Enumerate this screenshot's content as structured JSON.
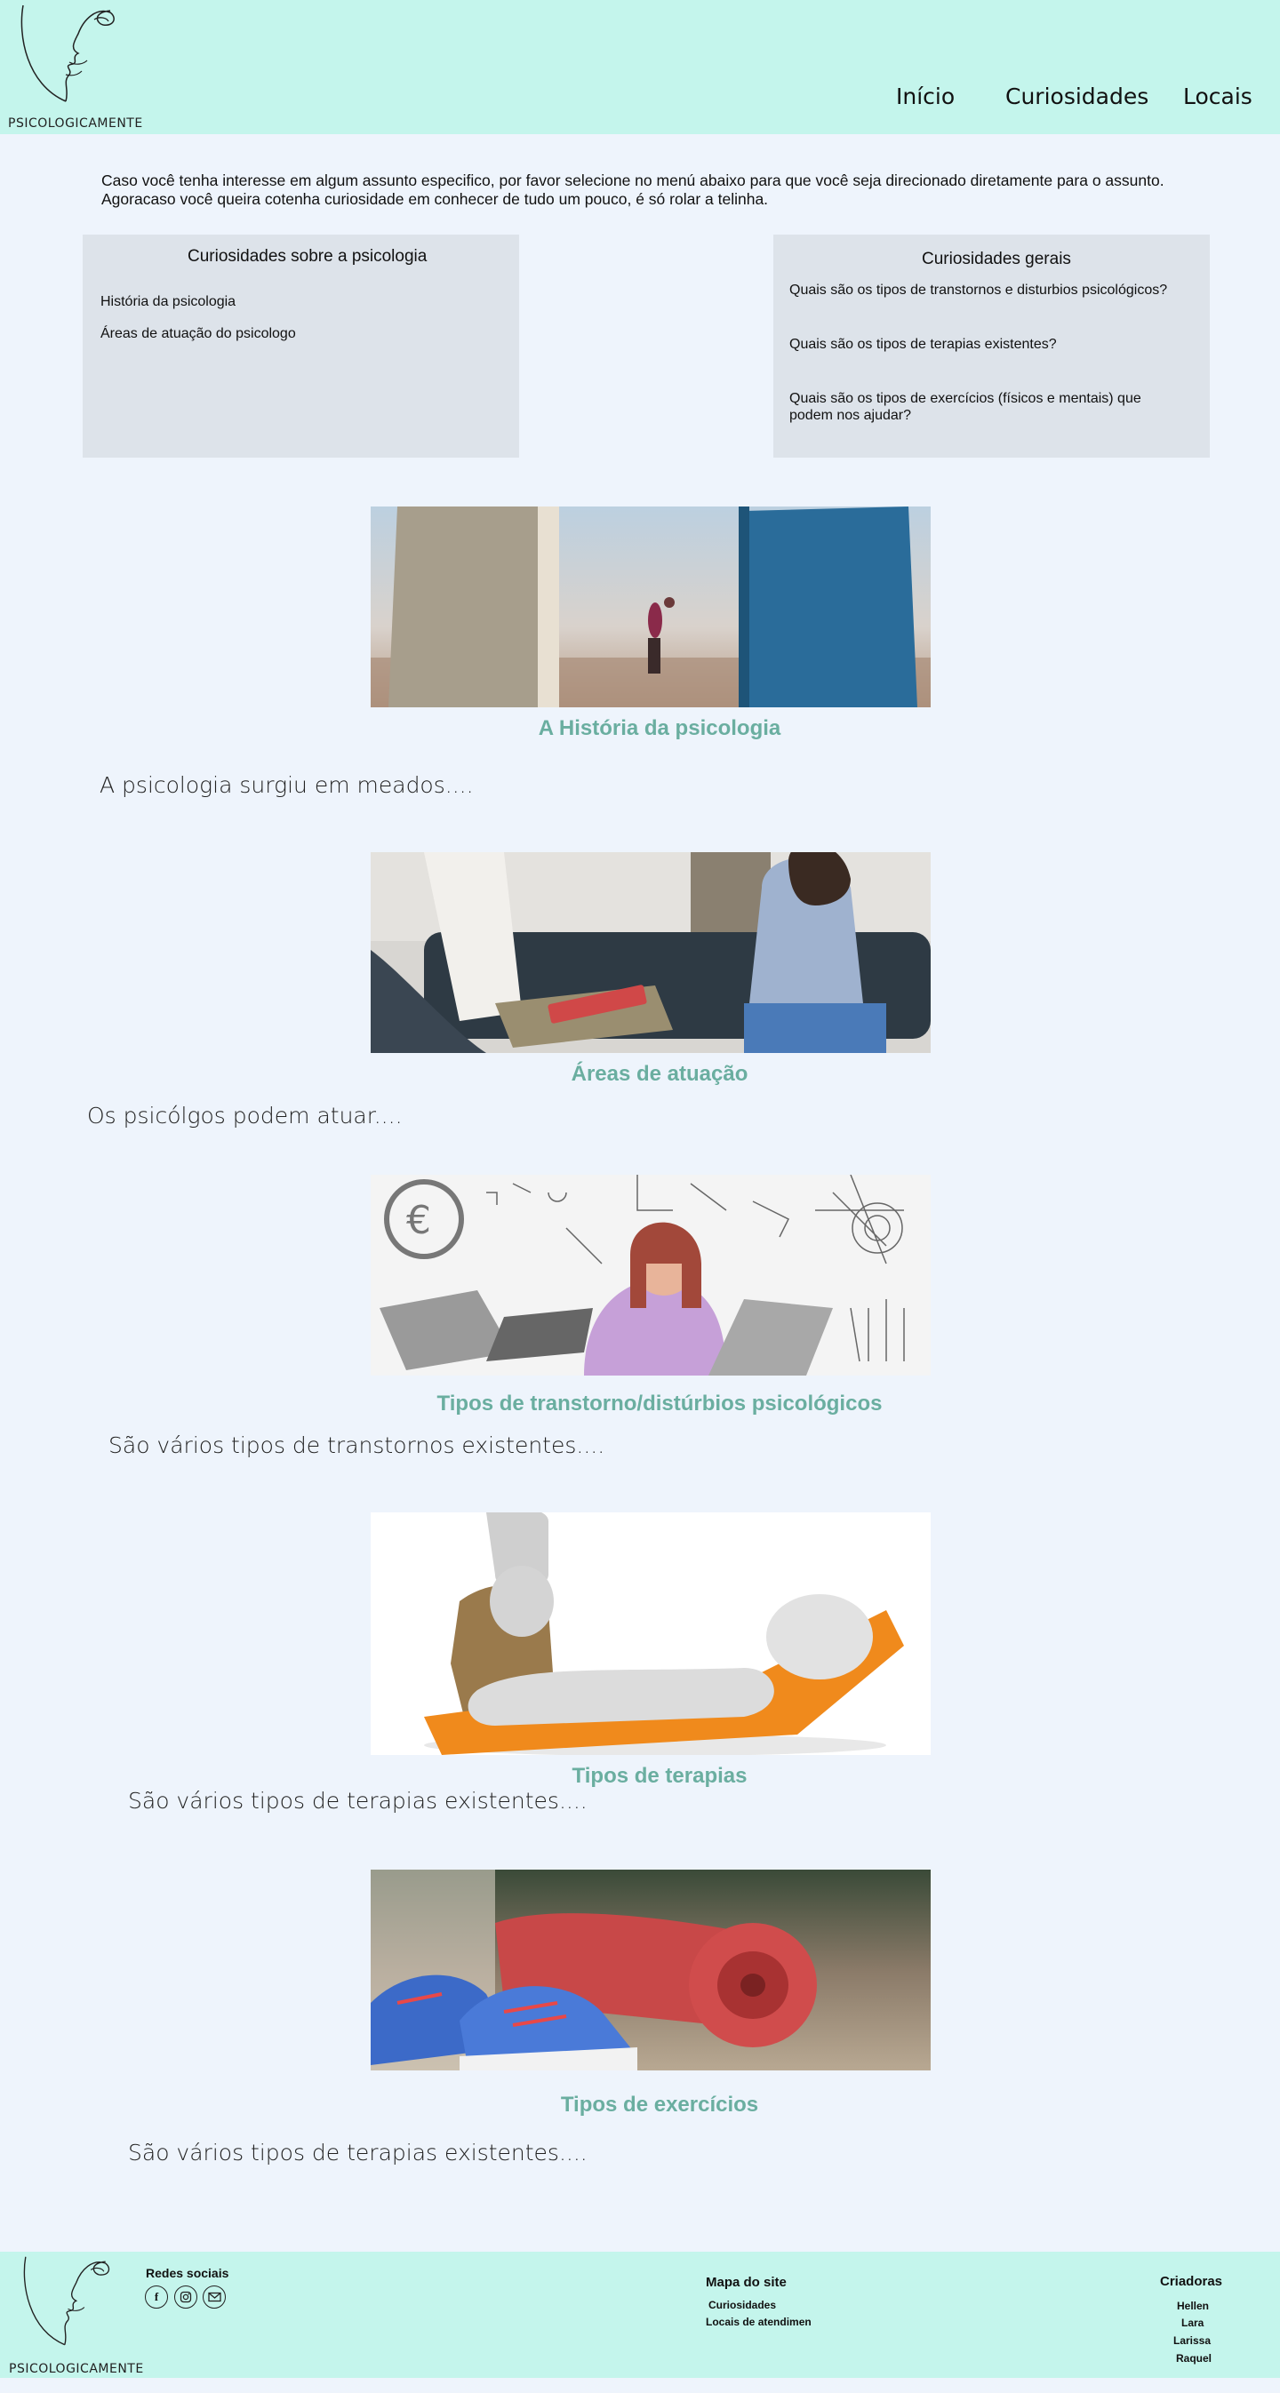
{
  "brand": {
    "name": "PSICOLOGICAMENTE"
  },
  "nav": {
    "items": [
      "Início",
      "Curiosidades",
      "Locais"
    ]
  },
  "intro": {
    "line1": "Caso você tenha interesse em algum assunto especifico, por favor selecione no menú abaixo para que você seja direcionado diretamente para o assunto.",
    "line2": "Agoracaso você queira cotenha curiosidade em conhecer de tudo um pouco, é só rolar a telinha."
  },
  "box_left": {
    "title": "Curiosidades sobre a psicologia",
    "links": [
      "História da psicologia",
      "Áreas de atuação do psicologo"
    ]
  },
  "box_right": {
    "title": "Curiosidades gerais",
    "links": [
      "Quais são os tipos de transtornos e disturbios psicológicos?",
      "Quais são os tipos de terapias existentes?",
      "Quais são os tipos de exercícios (físicos e mentais) que podem nos ajudar?"
    ]
  },
  "articles": [
    {
      "image_icon": "books-person-image",
      "title": "A História da psicologia",
      "text": "A psicologia surgiu em meados...."
    },
    {
      "image_icon": "therapy-session-image",
      "title": "Áreas de atuação",
      "text": "Os psicólgos podem atuar...."
    },
    {
      "image_icon": "stressed-woman-image",
      "title": "Tipos de transtorno/distúrbios psicológicos",
      "text": "São vários tipos de transtornos existentes...."
    },
    {
      "image_icon": "therapy-couch-figure-image",
      "title": "Tipos de terapias",
      "text": "São vários tipos de terapias existentes...."
    },
    {
      "image_icon": "sneakers-yoga-mat-image",
      "title": "Tipos de exercícios",
      "text": "São vários tipos de terapias existentes...."
    }
  ],
  "footer": {
    "social_heading": "Redes sociais",
    "social_icons": [
      "facebook-icon",
      "instagram-icon",
      "email-icon"
    ],
    "sitemap_heading": "Mapa do site",
    "sitemap_links": [
      "Curiosidades",
      "Locais de atendimento"
    ],
    "creators_heading": "Criadoras",
    "creators": [
      "Hellen",
      "Lara",
      "Larissa",
      "Raquel"
    ]
  },
  "colors": {
    "header_bg": "#c4f5ec",
    "page_bg": "#eef4fc",
    "box_bg": "#dde3ea",
    "title_accent": "#6aaea0"
  }
}
